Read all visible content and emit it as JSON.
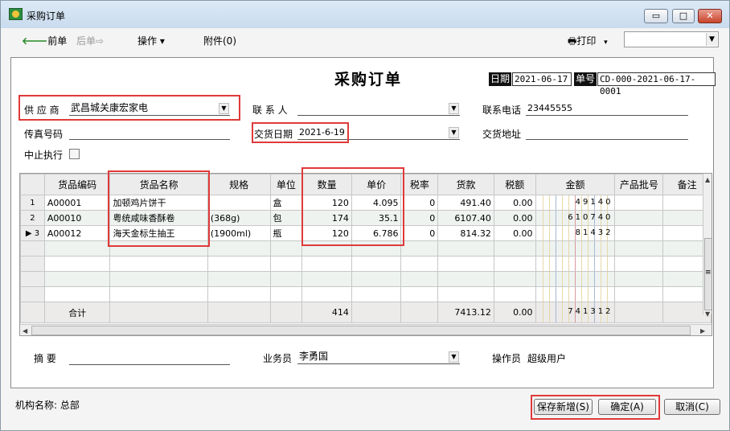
{
  "window": {
    "title": "采购订单",
    "controls": {
      "min": "▭",
      "max": "□",
      "close": "✕"
    }
  },
  "toolbar": {
    "prev_icon": "🡐",
    "prev": "前单",
    "next": "后单",
    "next_icon": "⇨",
    "operations": "操作",
    "operations_icon": "▾",
    "attachment": "附件(0)",
    "print_icon": "🖶",
    "print": "打印",
    "print_dd": "▾",
    "select_value": "",
    "select_dd": "▼"
  },
  "doc": {
    "title": "采购订单",
    "date_label": "日期",
    "date": "2021-06-17",
    "no_label": "单号",
    "no": "CD-000-2021-06-17-0001"
  },
  "fields": {
    "supplier_label": "供 应 商",
    "supplier": "武昌城关康宏家电",
    "contact_label": "联 系 人",
    "contact": "",
    "phone_label": "联系电话",
    "phone": "23445555",
    "fax_label": "传真号码",
    "fax": "",
    "delivery_date_label": "交货日期",
    "delivery_date": "2021-6-19",
    "delivery_addr_label": "交货地址",
    "delivery_addr": "",
    "suspend_label": "中止执行",
    "dd": "▼"
  },
  "grid": {
    "columns": [
      "",
      "货品编码",
      "货品名称",
      "规格",
      "单位",
      "数量",
      "单价",
      "税率",
      "货款",
      "税额",
      "金额",
      "产品批号",
      "备注"
    ],
    "rows": [
      {
        "rn": "1",
        "code": "A00001",
        "name": "加顿鸡片饼干",
        "spec": "",
        "unit": "盒",
        "qty": "120",
        "price": "4.095",
        "tax_rate": "0",
        "payment": "491.40",
        "tax": "0.00",
        "amount": "49140",
        "batch": ""
      },
      {
        "rn": "2",
        "code": "A00010",
        "name": "粤统咸味香酥卷",
        "spec": "(368g)",
        "unit": "包",
        "qty": "174",
        "price": "35.1",
        "tax_rate": "0",
        "payment": "6107.40",
        "tax": "0.00",
        "amount": "610740",
        "batch": ""
      },
      {
        "rn": "3",
        "code": "A00012",
        "name": "海天金标生抽王",
        "spec": "(1900ml)",
        "unit": "瓶",
        "qty": "120",
        "price": "6.786",
        "tax_rate": "0",
        "payment": "814.32",
        "tax": "0.00",
        "amount": "81432",
        "batch": ""
      }
    ],
    "current_row_marker": "▶",
    "total": {
      "label": "合计",
      "qty": "414",
      "payment": "7413.12",
      "tax": "0.00",
      "amount": "741312"
    },
    "scroll_up": "▲",
    "scroll_down": "▼",
    "scroll_left": "◀",
    "scroll_right": "▶",
    "grip": "≡"
  },
  "bottom_fields": {
    "summary_label": "摘  要",
    "summary": "",
    "salesman_label": "业务员",
    "salesman": "李勇国",
    "operator_label": "操作员",
    "operator": "超级用户"
  },
  "footer": {
    "org_label": "机构名称: 总部",
    "save_new": "保存新增(S)",
    "ok": "确定(A)",
    "cancel": "取消(C)"
  }
}
